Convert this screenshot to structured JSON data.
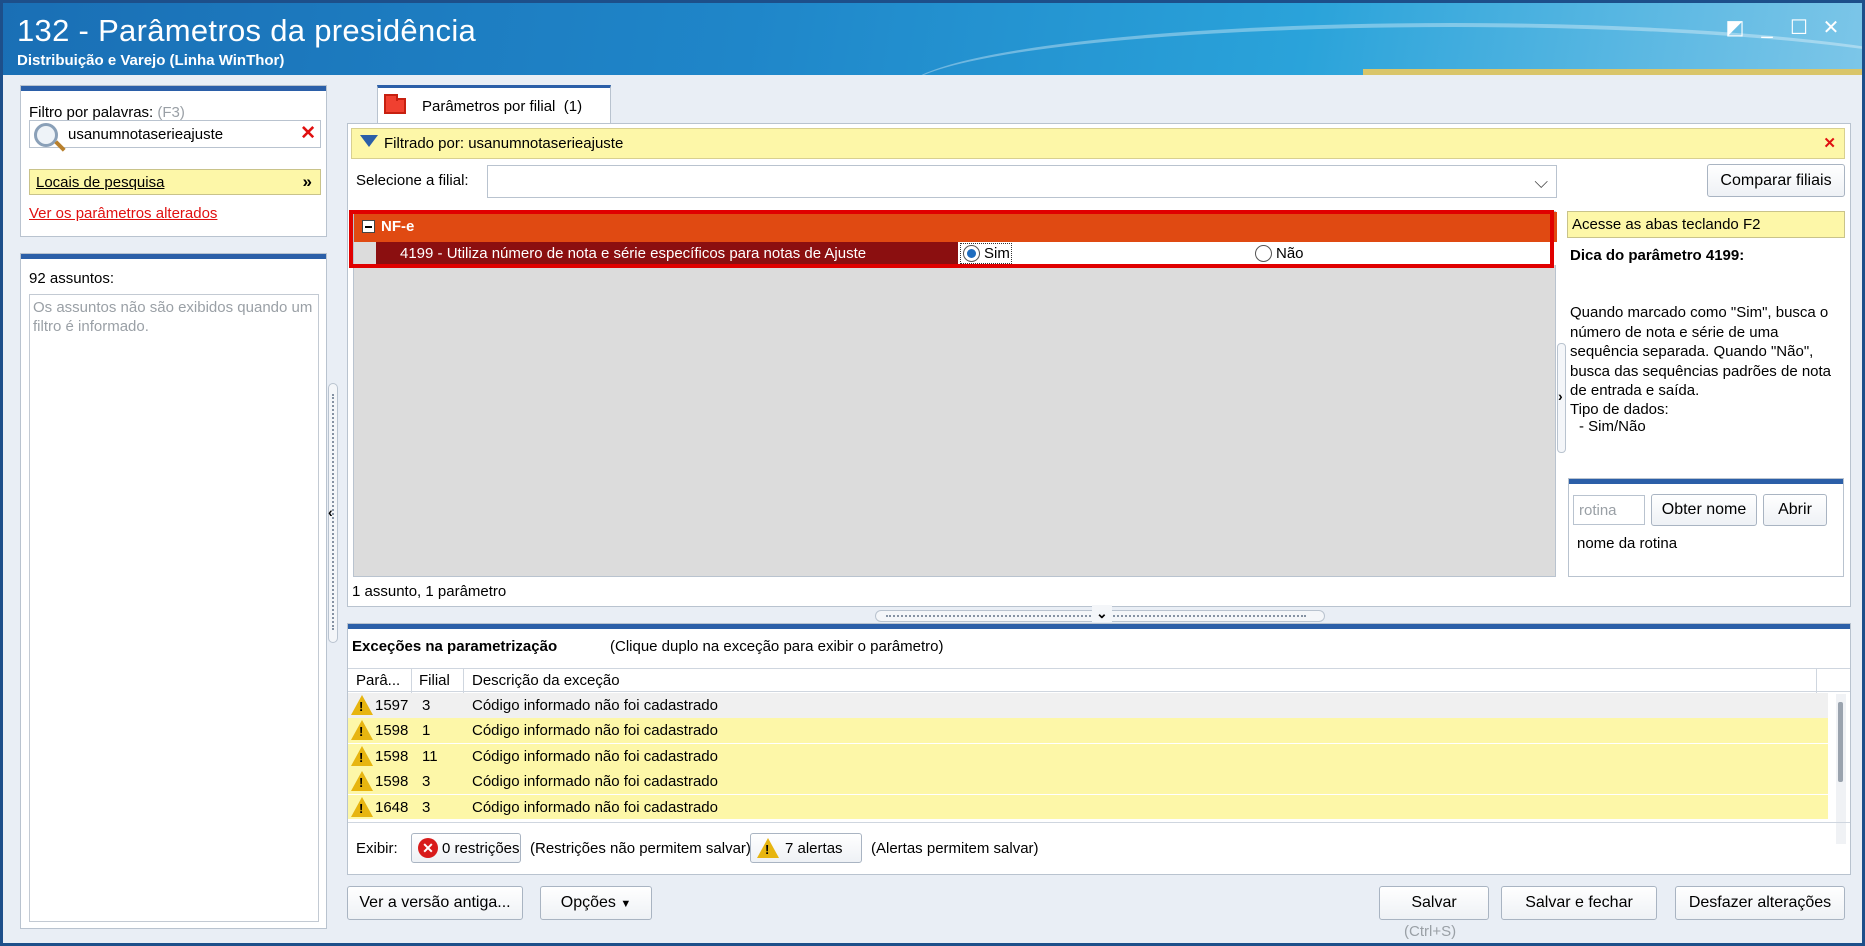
{
  "window": {
    "title": "132 - Parâmetros da presidência",
    "subtitle": "Distribuição e Varejo (Linha WinThor)"
  },
  "left": {
    "filter_label": "Filtro por palavras:",
    "filter_shortcut": "(F3)",
    "search_value": "usanumnotaserieajuste",
    "locais_label": "Locais de pesquisa",
    "changed_link": "Ver os parâmetros alterados",
    "subjects_count": "92 assuntos:",
    "subjects_hint": "Os assuntos não são exibidos quando um filtro é informado."
  },
  "tab": {
    "label": "Parâmetros por filial",
    "count": "(1)"
  },
  "filter_bar": {
    "text": "Filtrado por: usanumnotaserieajuste"
  },
  "filial": {
    "label": "Selecione a filial:",
    "value": "",
    "compare_button": "Comparar filiais"
  },
  "group": {
    "name": "NF-e"
  },
  "parameter": {
    "label": "4199 - Utiliza número de nota e série específicos para notas de Ajuste",
    "option_yes": "Sim",
    "option_no": "Não",
    "selected": "Sim"
  },
  "grid_footer": "1 assunto, 1 parâmetro",
  "tip": {
    "header": "Acesse as abas teclando F2",
    "title": "Dica do parâmetro 4199:",
    "body": "Quando marcado como \"Sim\", busca o número de nota e série de uma sequência separada. Quando \"Não\", busca das sequências padrões de nota de entrada e saída.",
    "data_type_label": "Tipo de dados:",
    "data_type_value": "- Sim/Não",
    "rotina_placeholder": "rotina",
    "obter_nome_button": "Obter nome",
    "abrir_button": "Abrir",
    "rotina_name_label": "nome da rotina"
  },
  "exceptions": {
    "title": "Exceções na parametrização",
    "hint": "(Clique duplo na exceção para exibir o parâmetro)",
    "columns": [
      "Parâ...",
      "Filial",
      "Descrição da exceção"
    ],
    "rows": [
      {
        "param": "1597",
        "filial": "3",
        "desc": "Código informado não foi cadastrado"
      },
      {
        "param": "1598",
        "filial": "1",
        "desc": "Código informado não foi cadastrado"
      },
      {
        "param": "1598",
        "filial": "11",
        "desc": "Código informado não foi cadastrado"
      },
      {
        "param": "1598",
        "filial": "3",
        "desc": "Código informado não foi cadastrado"
      },
      {
        "param": "1648",
        "filial": "3",
        "desc": "Código informado não foi cadastrado"
      }
    ],
    "exibir_label": "Exibir:",
    "restrictions_button": "0 restrições",
    "restrictions_note": "(Restrições não permitem salvar)",
    "alerts_button": "7 alertas",
    "alerts_note": "(Alertas permitem salvar)"
  },
  "footer": {
    "old_version_button": "Ver a versão antiga...",
    "options_button": "Opções",
    "save_button": "Salvar",
    "save_shortcut": "(Ctrl+S)",
    "save_close_button": "Salvar e fechar",
    "undo_button": "Desfazer alterações"
  }
}
